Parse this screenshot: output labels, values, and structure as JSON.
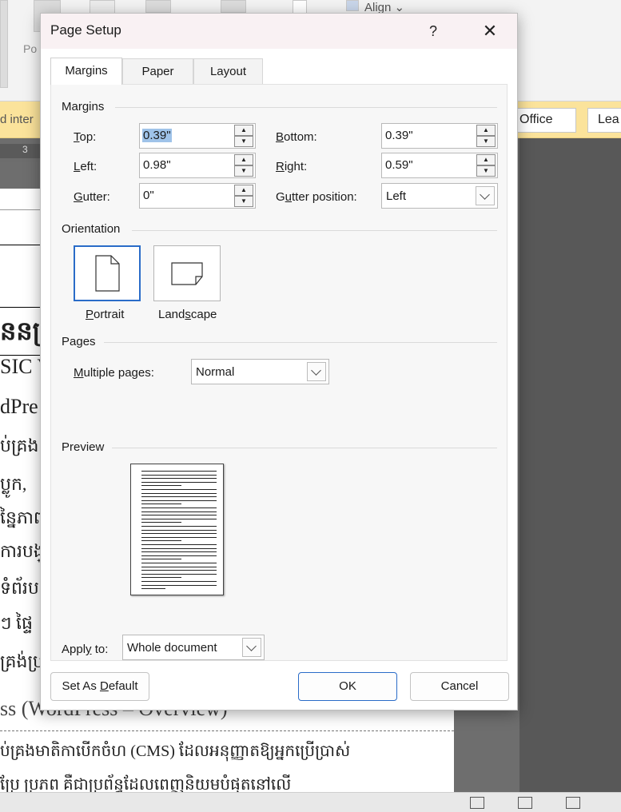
{
  "background": {
    "ribbon": {
      "partial_label": "Po",
      "align_label": "Align"
    },
    "notice": {
      "partial_text": "d inter",
      "office_btn": "Office",
      "partial_btn": "Lea"
    },
    "ruler_num": "3",
    "doc_lines": [
      "ននគ្រ",
      "SIC V",
      "dPre",
      "ប់គ្រង",
      "ប្លូក,",
      "ន្នៃភាព",
      "ការបង្",
      "ទំព័រប",
      "ៗ ផ្ទៃ",
      "គ្រង់ប្រ"
    ],
    "doc_heading_partial": "ss (WordPress – Overview)",
    "doc_para_1": "ប់គ្រងមាតិកាបើកចំហ (CMS) ដែលអនុញ្ញាតឱ្យអ្នកប្រើប្រាស់",
    "doc_para_2": "ប្រែ ប្រភព គឺជាប្រព័ន្ធដែលពេញនិយមបំផុតនៅលើ"
  },
  "dialog": {
    "title": "Page Setup",
    "help": "?",
    "tabs": [
      {
        "label": "Margins",
        "active": true
      },
      {
        "label": "Paper",
        "active": false
      },
      {
        "label": "Layout",
        "active": false
      }
    ],
    "margins": {
      "section": "Margins",
      "top": {
        "label_pre": "",
        "label_key": "T",
        "label_post": "op:",
        "value": "0.39\""
      },
      "bottom": {
        "label_pre": "",
        "label_key": "B",
        "label_post": "ottom:",
        "value": "0.39\""
      },
      "left": {
        "label_pre": "",
        "label_key": "L",
        "label_post": "eft:",
        "value": "0.98\""
      },
      "right": {
        "label_pre": "",
        "label_key": "R",
        "label_post": "ight:",
        "value": "0.59\""
      },
      "gutter": {
        "label_pre": "",
        "label_key": "G",
        "label_post": "utter:",
        "value": "0\""
      },
      "gutter_position": {
        "label_pre": "G",
        "label_key": "u",
        "label_post": "tter position:",
        "value": "Left"
      }
    },
    "orientation": {
      "section": "Orientation",
      "portrait": {
        "pre": "",
        "key": "P",
        "post": "ortrait",
        "selected": true
      },
      "landscape": {
        "pre": "Land",
        "key": "s",
        "post": "cape",
        "selected": false
      }
    },
    "pages": {
      "section": "Pages",
      "label_pre": "",
      "label_key": "M",
      "label_post": "ultiple pages:",
      "value": "Normal"
    },
    "preview": {
      "section": "Preview"
    },
    "apply_to": {
      "label_pre": "Appl",
      "label_key": "y",
      "label_post": " to:",
      "value": "Whole document"
    },
    "buttons": {
      "default_pre": "Set As ",
      "default_key": "D",
      "default_post": "efault",
      "ok": "OK",
      "cancel": "Cancel"
    },
    "colors": {
      "accent": "#2a6cc8",
      "selection": "#9fc3e9",
      "titlebar": "#f9f1f3"
    }
  }
}
